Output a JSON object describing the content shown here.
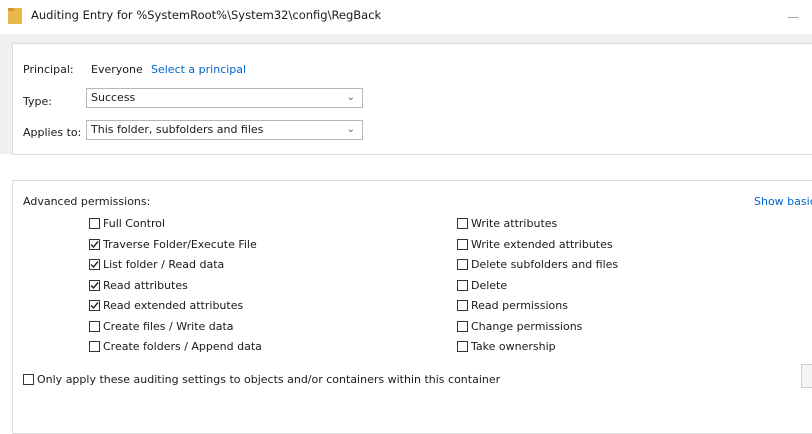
{
  "window": {
    "title": "Auditing Entry for %SystemRoot%\\System32\\config\\RegBack",
    "minimize_glyph": "—"
  },
  "principal": {
    "label": "Principal:",
    "value": "Everyone",
    "link": "Select a principal"
  },
  "type": {
    "label": "Type:",
    "value": "Success"
  },
  "applies_to": {
    "label": "Applies to:",
    "value": "This folder, subfolders and files"
  },
  "advanced": {
    "heading": "Advanced permissions:",
    "show_basic": "Show basic"
  },
  "permissions_left": [
    {
      "label": "Full Control",
      "checked": false
    },
    {
      "label": "Traverse Folder/Execute File",
      "checked": true
    },
    {
      "label": "List folder / Read data",
      "checked": true
    },
    {
      "label": "Read attributes",
      "checked": true
    },
    {
      "label": "Read extended attributes",
      "checked": true
    },
    {
      "label": "Create files / Write data",
      "checked": false
    },
    {
      "label": "Create folders / Append data",
      "checked": false
    }
  ],
  "permissions_right": [
    {
      "label": "Write attributes",
      "checked": false
    },
    {
      "label": "Write extended attributes",
      "checked": false
    },
    {
      "label": "Delete subfolders and files",
      "checked": false
    },
    {
      "label": "Delete",
      "checked": false
    },
    {
      "label": "Read permissions",
      "checked": false
    },
    {
      "label": "Change permissions",
      "checked": false
    },
    {
      "label": "Take ownership",
      "checked": false
    }
  ],
  "only_apply": {
    "label": "Only apply these auditing settings to objects and/or containers within this container",
    "checked": false
  },
  "colors": {
    "link": "#0066cc",
    "folder": "#e8b84a"
  },
  "icons": {
    "folder": "folder-icon",
    "dropdown": "chevron-down-icon",
    "checkmark": "checkmark-icon"
  }
}
